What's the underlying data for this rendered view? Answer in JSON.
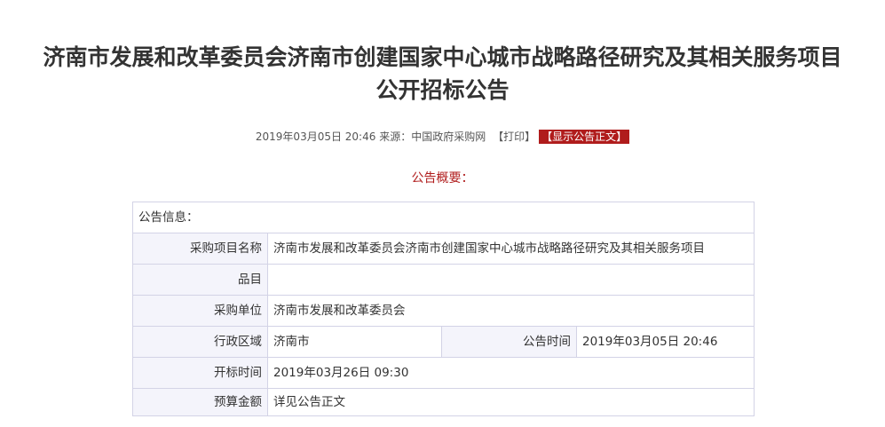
{
  "title": {
    "line1": "济南市发展和改革委员会济南市创建国家中心城市战略路径研究及其相关服务项目",
    "line2": "公开招标公告"
  },
  "meta": {
    "datetime": "2019年03月05日 20:46",
    "source_label": "来源：",
    "source": "中国政府采购网",
    "print": "【打印】",
    "show_full": "【显示公告正文】"
  },
  "summary_title": "公告概要：",
  "info": {
    "section_label": "公告信息：",
    "rows": {
      "project_name": {
        "label": "采购项目名称",
        "value": "济南市发展和改革委员会济南市创建国家中心城市战略路径研究及其相关服务项目"
      },
      "category": {
        "label": "品目",
        "value": ""
      },
      "purchaser": {
        "label": "采购单位",
        "value": "济南市发展和改革委员会"
      },
      "region": {
        "label": "行政区域",
        "value": "济南市"
      },
      "announce_time": {
        "label": "公告时间",
        "value": "2019年03月05日 20:46"
      },
      "bid_open_time": {
        "label": "开标时间",
        "value": "2019年03月26日 09:30"
      },
      "budget": {
        "label": "预算金额",
        "value": "详见公告正文"
      }
    }
  },
  "colors": {
    "accent_red": "#b01c1c",
    "label_bg": "#f4f4fb",
    "border": "#d3d3e6",
    "text": "#333333"
  }
}
